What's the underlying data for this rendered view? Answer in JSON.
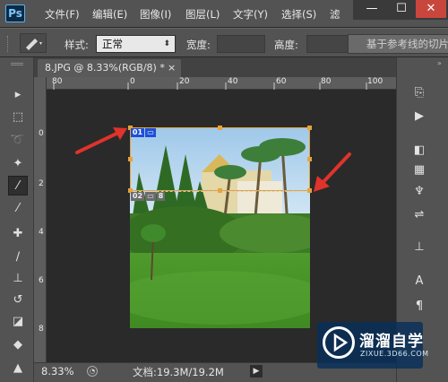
{
  "app": {
    "logo": "Ps"
  },
  "menu": [
    "文件(F)",
    "编辑(E)",
    "图像(I)",
    "图层(L)",
    "文字(Y)",
    "选择(S)",
    "滤"
  ],
  "window_controls": {
    "minimize": "—",
    "maximize": "☐",
    "close": "✕"
  },
  "options_bar": {
    "style_label": "样式:",
    "style_value": "正常",
    "width_label": "宽度:",
    "height_label": "高度:",
    "guide_button": "基于参考线的切片"
  },
  "document": {
    "tab_title": "8.JPG @ 8.33%(RGB/8) *",
    "tab_close": "×"
  },
  "ruler": {
    "h_ticks": [
      "80",
      "0",
      "20",
      "40",
      "60",
      "80",
      "100"
    ],
    "v_ticks": [
      "0",
      "2",
      "4",
      "6",
      "8"
    ]
  },
  "slices": [
    {
      "number": "01",
      "icon": "slice-image-icon"
    },
    {
      "number": "02",
      "icon": "slice-image-icon",
      "extra": "8"
    }
  ],
  "status": {
    "zoom": "8.33%",
    "doc_info": "文档:19.3M/19.2M"
  },
  "watermark": {
    "name": "溜溜自学",
    "url": "ZIXUE.3D66.COM"
  },
  "colors": {
    "accent_arrow": "#e0332b",
    "slice_border": "#e6a43a",
    "badge_blue": "#1e4fd8"
  }
}
